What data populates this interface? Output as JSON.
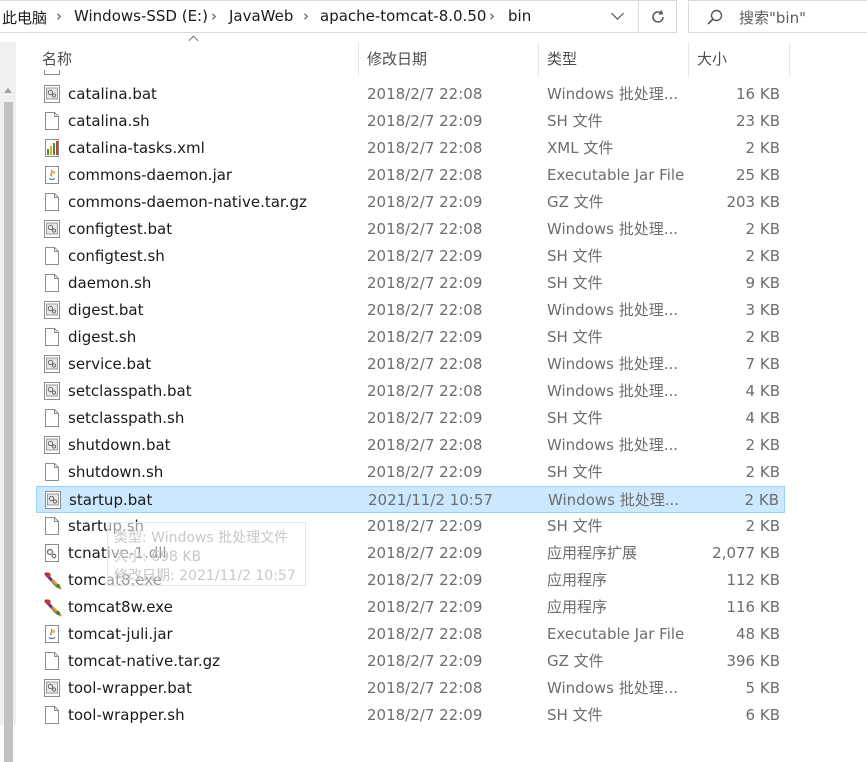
{
  "address_bar": {
    "crumbs": [
      "此电脑",
      "Windows-SSD (E:)",
      "JavaWeb",
      "apache-tomcat-8.0.50",
      "bin"
    ]
  },
  "search": {
    "placeholder": "搜索\"bin\""
  },
  "columns": {
    "name": "名称",
    "date": "修改日期",
    "type": "类型",
    "size": "大小"
  },
  "files": [
    {
      "name": "catalina.bat",
      "date": "2018/2/7 22:08",
      "type": "Windows 批处理...",
      "size": "16 KB",
      "icon": "batch-file-icon"
    },
    {
      "name": "catalina.sh",
      "date": "2018/2/7 22:09",
      "type": "SH 文件",
      "size": "23 KB",
      "icon": "document-file-icon"
    },
    {
      "name": "catalina-tasks.xml",
      "date": "2018/2/7 22:08",
      "type": "XML 文件",
      "size": "2 KB",
      "icon": "xml-file-icon"
    },
    {
      "name": "commons-daemon.jar",
      "date": "2018/2/7 22:08",
      "type": "Executable Jar File",
      "size": "25 KB",
      "icon": "java-jar-icon"
    },
    {
      "name": "commons-daemon-native.tar.gz",
      "date": "2018/2/7 22:09",
      "type": "GZ 文件",
      "size": "203 KB",
      "icon": "document-file-icon"
    },
    {
      "name": "configtest.bat",
      "date": "2018/2/7 22:08",
      "type": "Windows 批处理...",
      "size": "2 KB",
      "icon": "batch-file-icon"
    },
    {
      "name": "configtest.sh",
      "date": "2018/2/7 22:09",
      "type": "SH 文件",
      "size": "2 KB",
      "icon": "document-file-icon"
    },
    {
      "name": "daemon.sh",
      "date": "2018/2/7 22:09",
      "type": "SH 文件",
      "size": "9 KB",
      "icon": "document-file-icon"
    },
    {
      "name": "digest.bat",
      "date": "2018/2/7 22:08",
      "type": "Windows 批处理...",
      "size": "3 KB",
      "icon": "batch-file-icon"
    },
    {
      "name": "digest.sh",
      "date": "2018/2/7 22:09",
      "type": "SH 文件",
      "size": "2 KB",
      "icon": "document-file-icon"
    },
    {
      "name": "service.bat",
      "date": "2018/2/7 22:08",
      "type": "Windows 批处理...",
      "size": "7 KB",
      "icon": "batch-file-icon"
    },
    {
      "name": "setclasspath.bat",
      "date": "2018/2/7 22:08",
      "type": "Windows 批处理...",
      "size": "4 KB",
      "icon": "batch-file-icon"
    },
    {
      "name": "setclasspath.sh",
      "date": "2018/2/7 22:09",
      "type": "SH 文件",
      "size": "4 KB",
      "icon": "document-file-icon"
    },
    {
      "name": "shutdown.bat",
      "date": "2018/2/7 22:08",
      "type": "Windows 批处理...",
      "size": "2 KB",
      "icon": "batch-file-icon"
    },
    {
      "name": "shutdown.sh",
      "date": "2018/2/7 22:09",
      "type": "SH 文件",
      "size": "2 KB",
      "icon": "document-file-icon"
    },
    {
      "name": "startup.bat",
      "date": "2021/11/2 10:57",
      "type": "Windows 批处理...",
      "size": "2 KB",
      "icon": "batch-file-icon",
      "selected": true
    },
    {
      "name": "startup.sh",
      "date": "2018/2/7 22:09",
      "type": "SH 文件",
      "size": "2 KB",
      "icon": "document-file-icon"
    },
    {
      "name": "tcnative-1.dll",
      "date": "2018/2/7 22:09",
      "type": "应用程序扩展",
      "size": "2,077 KB",
      "icon": "dll-file-icon"
    },
    {
      "name": "tomcat8.exe",
      "date": "2018/2/7 22:09",
      "type": "应用程序",
      "size": "112 KB",
      "icon": "tomcat-exe-icon"
    },
    {
      "name": "tomcat8w.exe",
      "date": "2018/2/7 22:09",
      "type": "应用程序",
      "size": "116 KB",
      "icon": "tomcat-exe-icon"
    },
    {
      "name": "tomcat-juli.jar",
      "date": "2018/2/7 22:08",
      "type": "Executable Jar File",
      "size": "48 KB",
      "icon": "java-jar-icon"
    },
    {
      "name": "tomcat-native.tar.gz",
      "date": "2018/2/7 22:09",
      "type": "GZ 文件",
      "size": "396 KB",
      "icon": "document-file-icon"
    },
    {
      "name": "tool-wrapper.bat",
      "date": "2018/2/7 22:08",
      "type": "Windows 批处理...",
      "size": "5 KB",
      "icon": "batch-file-icon"
    },
    {
      "name": "tool-wrapper.sh",
      "date": "2018/2/7 22:09",
      "type": "SH 文件",
      "size": "6 KB",
      "icon": "document-file-icon"
    }
  ],
  "tooltip": {
    "type_line": "类型: Windows 批处理文件",
    "size_line": "大小: 698 KB",
    "date_line": "修改日期: 2021/11/2 10:57"
  },
  "colors": {
    "selection_bg": "#cce8ff",
    "selection_border": "#99d1ff"
  }
}
